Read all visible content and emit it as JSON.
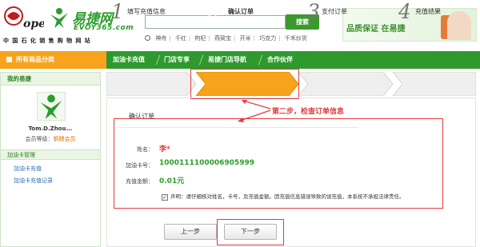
{
  "header": {
    "sinopec_tagline": "中国石化销售购物网站",
    "brand_cn": "易捷网",
    "brand_en": "EVOY365.com",
    "search_button": "搜索",
    "search_value": "",
    "hot_keywords": [
      "神舟",
      "千红",
      "枸杞",
      "燕窝宝",
      "开米",
      "巧克力",
      "千禾炒货"
    ],
    "promo_text": "品质保证 在易捷"
  },
  "nav": {
    "category": "所有商品分类",
    "items": [
      "加油卡充值",
      "门店专享",
      "易捷门店导航",
      "合作伙伴"
    ]
  },
  "sidebar": {
    "title": "我的易捷",
    "user_name": "Tom.D.Zhou...",
    "level_label": "会员等级：",
    "level_value": "铜牌会员",
    "section": "加油卡管理",
    "links": [
      "加油卡充值",
      "加油卡充值记录"
    ]
  },
  "steps": [
    {
      "num": "1",
      "label": "填写充值信息"
    },
    {
      "num": "2",
      "label": "确认订单"
    },
    {
      "num": "3",
      "label": "支付订单"
    },
    {
      "num": "4",
      "label": "充值结果"
    }
  ],
  "content": {
    "title": "确认订单",
    "annotation": "第二步，检查订单信息",
    "name_label": "姓名：",
    "name_value": "李*",
    "card_label": "加油卡号：",
    "card_value": "1000111100006905999",
    "amount_label": "充值金额：",
    "amount_value": "0.01元",
    "declaration_checkbox": "✓",
    "declaration": "声明：请仔细核对姓名，卡号，及充值金额。因充值信息错误导致的误充值，本系统不承担法律责任。",
    "prev_button": "上一步",
    "next_button": "下一步"
  },
  "colors": {
    "brand_green": "#2e9a2e",
    "accent_orange": "#f7a31c",
    "alert_red": "#e23b3b"
  }
}
